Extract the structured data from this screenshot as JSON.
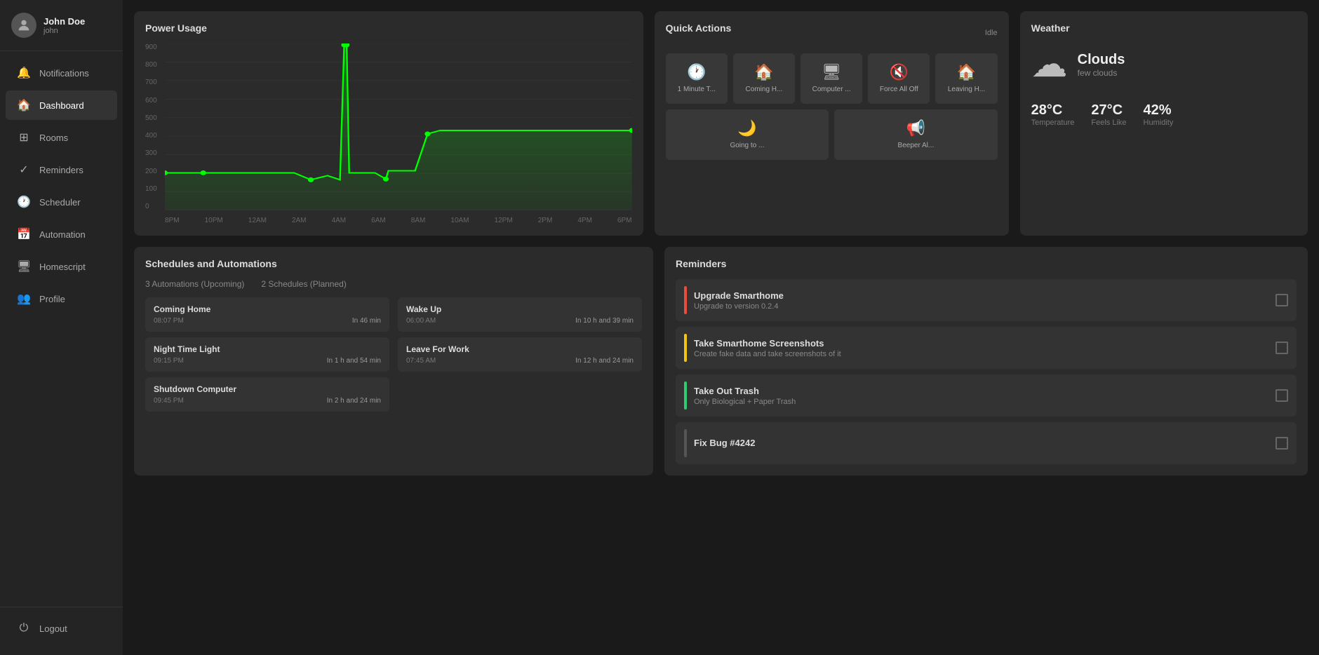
{
  "sidebar": {
    "user": {
      "name": "John Doe",
      "login": "john"
    },
    "nav": [
      {
        "id": "notifications",
        "label": "Notifications",
        "icon": "🔔"
      },
      {
        "id": "dashboard",
        "label": "Dashboard",
        "icon": "🏠",
        "active": true
      },
      {
        "id": "rooms",
        "label": "Rooms",
        "icon": "⊞"
      },
      {
        "id": "reminders",
        "label": "Reminders",
        "icon": "✓"
      },
      {
        "id": "scheduler",
        "label": "Scheduler",
        "icon": "🕐"
      },
      {
        "id": "automation",
        "label": "Automation",
        "icon": "📅"
      },
      {
        "id": "homescript",
        "label": "Homescript",
        "icon": "🖥"
      },
      {
        "id": "profile",
        "label": "Profile",
        "icon": "👥"
      }
    ],
    "logout_label": "Logout"
  },
  "power_usage": {
    "title": "Power Usage",
    "y_labels": [
      "900",
      "800",
      "700",
      "600",
      "500",
      "400",
      "300",
      "200",
      "100",
      "0"
    ],
    "x_labels": [
      "8PM",
      "10PM",
      "12AM",
      "2AM",
      "4AM",
      "6AM",
      "8AM",
      "10AM",
      "12PM",
      "2PM",
      "4PM",
      "6PM"
    ]
  },
  "quick_actions": {
    "title": "Quick Actions",
    "idle": "Idle",
    "buttons": [
      {
        "id": "1min",
        "label": "1 Minute T...",
        "icon": "🕐"
      },
      {
        "id": "coming-home",
        "label": "Coming H...",
        "icon": "🏠"
      },
      {
        "id": "computer",
        "label": "Computer ...",
        "icon": "🖥"
      },
      {
        "id": "force-all-off",
        "label": "Force All Off",
        "icon": "🔇"
      },
      {
        "id": "leaving-home",
        "label": "Leaving H...",
        "icon": "🏠"
      },
      {
        "id": "going-to",
        "label": "Going to ...",
        "icon": "🌙"
      },
      {
        "id": "beeper",
        "label": "Beeper Al...",
        "icon": "📢"
      }
    ]
  },
  "weather": {
    "title": "Weather",
    "condition": "Clouds",
    "description": "few clouds",
    "temperature": "28°C",
    "feels_like": "27°C",
    "humidity": "42%",
    "temp_label": "Temperature",
    "feels_label": "Feels Like",
    "humidity_label": "Humidity"
  },
  "schedules": {
    "title": "Schedules and Automations",
    "automations_header": "3 Automations (Upcoming)",
    "schedules_header": "2 Schedules (Planned)",
    "automations": [
      {
        "name": "Coming Home",
        "time": "08:07 PM",
        "countdown": "In 46 min"
      },
      {
        "name": "Night Time Light",
        "time": "09:15 PM",
        "countdown": "In 1 h and 54 min"
      },
      {
        "name": "Shutdown Computer",
        "time": "09:45 PM",
        "countdown": "In 2 h and 24 min"
      }
    ],
    "schedules_list": [
      {
        "name": "Wake Up",
        "time": "06:00 AM",
        "countdown": "In 10 h and 39 min"
      },
      {
        "name": "Leave For Work",
        "time": "07:45 AM",
        "countdown": "In 12 h and 24 min"
      }
    ]
  },
  "reminders": {
    "title": "Reminders",
    "items": [
      {
        "title": "Upgrade Smarthome",
        "sub": "Upgrade to version 0.2.4",
        "priority": "red"
      },
      {
        "title": "Take Smarthome Screenshots",
        "sub": "Create fake data and take screenshots of it",
        "priority": "yellow"
      },
      {
        "title": "Take Out Trash",
        "sub": "Only Biological + Paper Trash",
        "priority": "green"
      },
      {
        "title": "Fix Bug #4242",
        "sub": "",
        "priority": "gray"
      }
    ]
  }
}
